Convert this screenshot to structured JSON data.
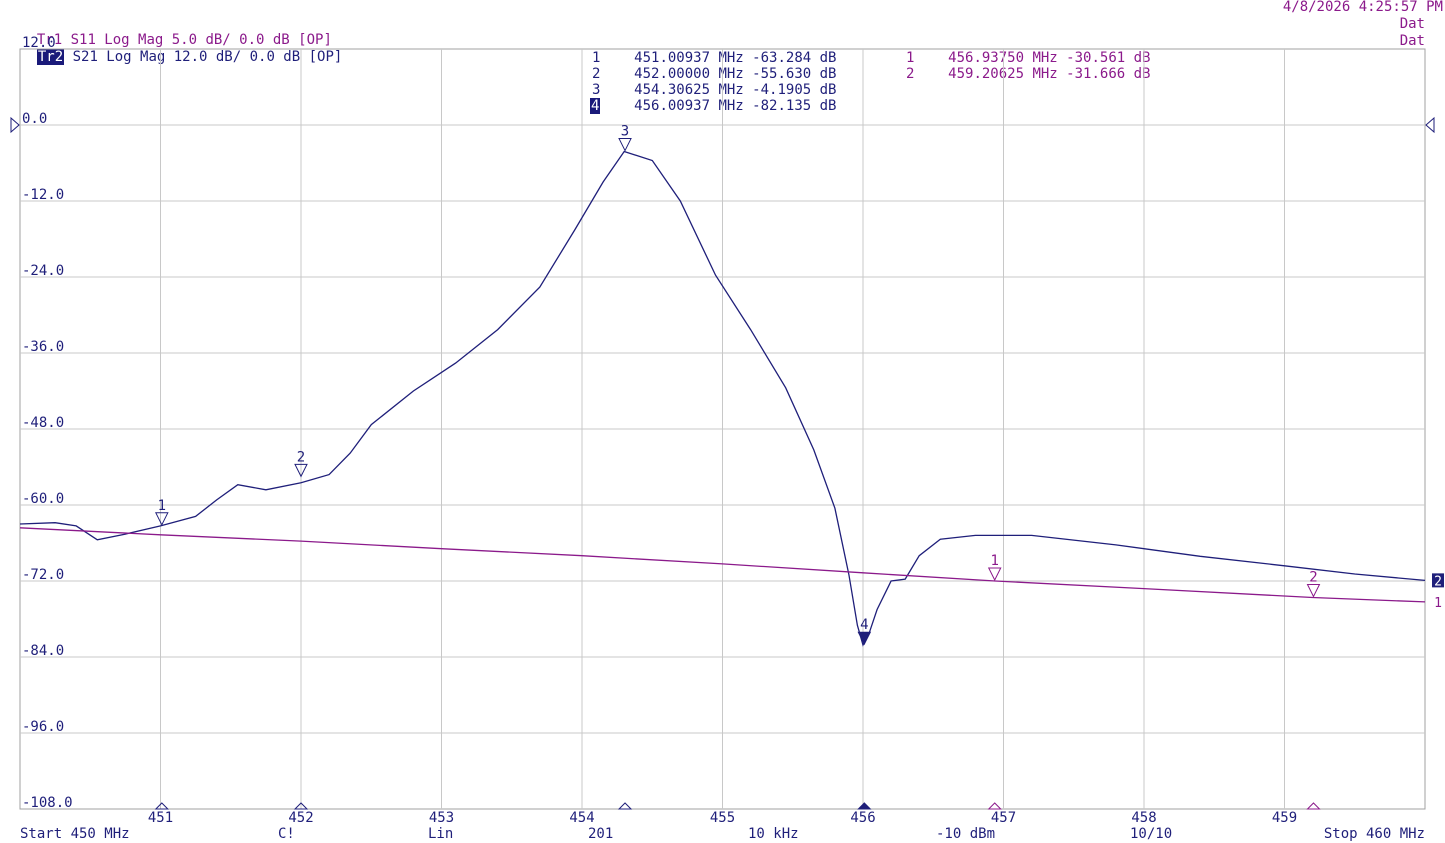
{
  "header": {
    "timestamp": "4/8/2026 4:25:57 PM",
    "traces": [
      {
        "tag": "Tr1",
        "text": "S11 Log Mag 5.0 dB/ 0.0 dB [OP]",
        "status": "Dat"
      },
      {
        "tag": "Tr2",
        "text": "S21 Log Mag 12.0 dB/ 0.0 dB [OP]",
        "status": "Dat"
      }
    ]
  },
  "colors": {
    "tr1": "#8b1a8b",
    "tr2": "#1f1f7a",
    "grid": "#c8c8c8"
  },
  "marker_table_tr2": [
    {
      "n": "1",
      "freq": "451.00937 MHz",
      "val": "-63.284 dB"
    },
    {
      "n": "2",
      "freq": "452.00000 MHz",
      "val": "-55.630 dB"
    },
    {
      "n": "3",
      "freq": "454.30625 MHz",
      "val": "-4.1905 dB"
    },
    {
      "n": "4",
      "freq": "456.00937 MHz",
      "val": "-82.135 dB",
      "active": true
    }
  ],
  "marker_table_tr1": [
    {
      "n": "1",
      "freq": "456.93750 MHz",
      "val": "-30.561 dB"
    },
    {
      "n": "2",
      "freq": "459.20625 MHz",
      "val": "-31.666 dB"
    }
  ],
  "footer": {
    "start": "Start 450 MHz",
    "cal": "C!",
    "sweep": "Lin",
    "points": "201",
    "ifbw": "10 kHz",
    "power": "-10 dBm",
    "avg": "10/10",
    "stop": "Stop 460 MHz"
  },
  "trace_labels": {
    "tr1": "1",
    "tr2": "2"
  },
  "chart_data": {
    "type": "line",
    "xlim": [
      450,
      460
    ],
    "ylim": [
      -108,
      12
    ],
    "x_ticks": [
      451,
      452,
      453,
      454,
      455,
      456,
      457,
      458,
      459
    ],
    "x_tick_labels": [
      "451",
      "452",
      "453",
      "454",
      "455",
      "456",
      "457",
      "458",
      "459"
    ],
    "y_ticks": [
      12,
      0,
      -12,
      -24,
      -36,
      -48,
      -60,
      -72,
      -84,
      -96,
      -108
    ],
    "y_tick_labels": [
      "12.0",
      "0.0",
      "-12.0",
      "-24.0",
      "-36.0",
      "-48.0",
      "-60.0",
      "-72.0",
      "-84.0",
      "-96.0",
      "-108.0"
    ],
    "grid": true,
    "series": [
      {
        "name": "S21",
        "color": "#1f1f7a",
        "x": [
          450.0,
          450.25,
          450.4,
          450.55,
          450.75,
          451.0,
          451.25,
          451.4,
          451.55,
          451.75,
          452.0,
          452.2,
          452.35,
          452.5,
          452.8,
          453.1,
          453.4,
          453.7,
          453.95,
          454.15,
          454.3,
          454.5,
          454.7,
          454.95,
          455.2,
          455.45,
          455.65,
          455.8,
          455.9,
          455.96,
          456.0,
          456.04,
          456.1,
          456.2,
          456.3,
          456.4,
          456.55,
          456.8,
          457.2,
          457.8,
          458.4,
          459.0,
          459.5,
          460.0
        ],
        "y": [
          -63.0,
          -62.8,
          -63.3,
          -65.5,
          -64.6,
          -63.3,
          -61.8,
          -59.2,
          -56.8,
          -57.6,
          -56.5,
          -55.2,
          -51.8,
          -47.3,
          -42.0,
          -37.6,
          -32.3,
          -25.6,
          -16.5,
          -9.0,
          -4.19,
          -5.6,
          -12.0,
          -23.7,
          -32.3,
          -41.5,
          -51.3,
          -60.5,
          -71.0,
          -79.0,
          -82.1,
          -80.5,
          -76.5,
          -72.0,
          -71.7,
          -68.0,
          -65.4,
          -64.8,
          -64.8,
          -66.3,
          -68.1,
          -69.6,
          -70.9,
          -71.9
        ]
      },
      {
        "name": "S11",
        "color": "#8b1a8b",
        "x": [
          450.0,
          451.0,
          452.0,
          453.0,
          454.0,
          455.0,
          456.0,
          456.94,
          458.0,
          459.2,
          460.0
        ],
        "y": [
          -63.6,
          -64.7,
          -65.7,
          -66.9,
          -68.0,
          -69.3,
          -70.7,
          -72.0,
          -73.2,
          -74.6,
          -75.3
        ]
      }
    ],
    "markers": [
      {
        "trace": "S21",
        "label": "1",
        "x": 451.00937,
        "y": -63.284
      },
      {
        "trace": "S21",
        "label": "2",
        "x": 452.0,
        "y": -55.63
      },
      {
        "trace": "S21",
        "label": "3",
        "x": 454.30625,
        "y": -4.1905
      },
      {
        "trace": "S21",
        "label": "4",
        "x": 456.00937,
        "y": -82.135,
        "active": true
      },
      {
        "trace": "S11",
        "label": "1",
        "x": 456.9375,
        "y": -30.561
      },
      {
        "trace": "S11",
        "label": "2",
        "x": 459.20625,
        "y": -31.666
      }
    ]
  }
}
